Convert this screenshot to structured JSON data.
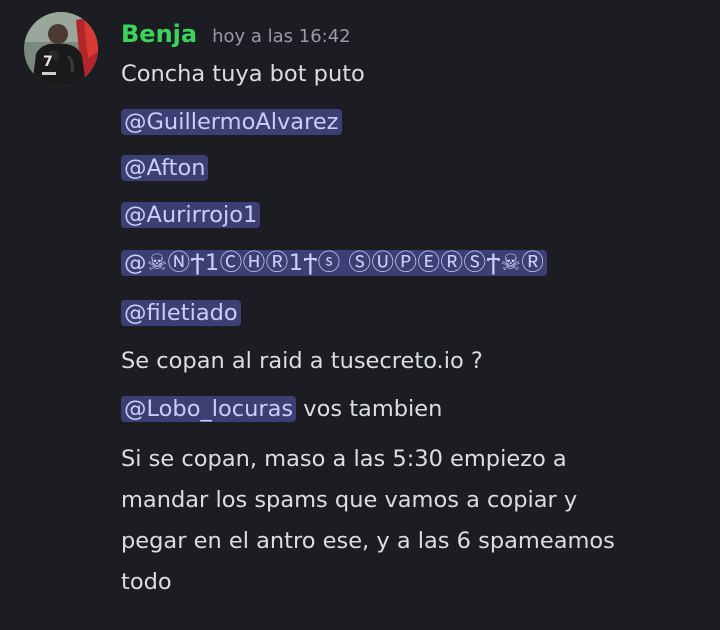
{
  "message": {
    "author": "Benja",
    "timestamp": "hoy a las 16:42",
    "username_color": "#3cd35d",
    "mention_bg": "#3d3f74",
    "mention_text": "#c9cdfb",
    "avatar_icon": "user-avatar-soccer-player",
    "lines": {
      "l1": "Concha tuya bot puto",
      "m1": "@GuillermoAlvarez",
      "m2": "@Afton",
      "m3": "@Aurirrojo1",
      "m4": "@☠ⓃϮ1ⒸⒽⓇ1Ϯⓢ ⓈⓊⓅⒺⓇⓈϮ☠Ⓡ",
      "m5": "@filetiado",
      "l2": "Se copan al raid a tusecreto.io ?",
      "m6": "@Lobo_locuras",
      "l3_suffix": " vos tambien",
      "p1": "Si se copan, maso a las 5:30 empiezo a",
      "p2": "mandar los spams que vamos a copiar y",
      "p3": "pegar en el antro ese, y a las 6 spameamos",
      "p4": "todo"
    }
  }
}
